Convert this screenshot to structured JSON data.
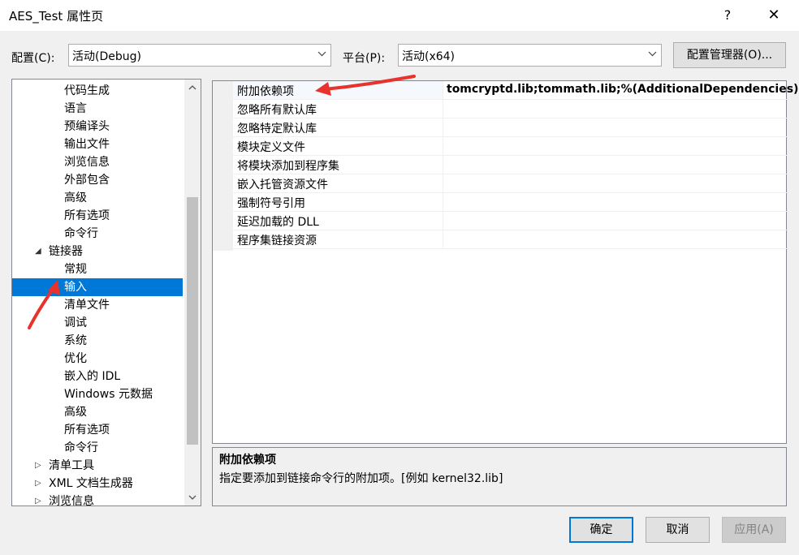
{
  "window": {
    "title": "AES_Test 属性页",
    "help_glyph": "?",
    "close_glyph": "✕"
  },
  "config": {
    "config_label": "配置(C):",
    "config_value": "活动(Debug)",
    "platform_label": "平台(P):",
    "platform_value": "活动(x64)",
    "manager_button": "配置管理器(O)..."
  },
  "tree": {
    "items": [
      {
        "label": "代码生成",
        "level": 2
      },
      {
        "label": "语言",
        "level": 2
      },
      {
        "label": "预编译头",
        "level": 2
      },
      {
        "label": "输出文件",
        "level": 2
      },
      {
        "label": "浏览信息",
        "level": 2
      },
      {
        "label": "外部包含",
        "level": 2
      },
      {
        "label": "高级",
        "level": 2
      },
      {
        "label": "所有选项",
        "level": 2
      },
      {
        "label": "命令行",
        "level": 2
      },
      {
        "label": "链接器",
        "level": 1,
        "expander": "◢"
      },
      {
        "label": "常规",
        "level": 2
      },
      {
        "label": "输入",
        "level": 2,
        "selected": true
      },
      {
        "label": "清单文件",
        "level": 2
      },
      {
        "label": "调试",
        "level": 2
      },
      {
        "label": "系统",
        "level": 2
      },
      {
        "label": "优化",
        "level": 2
      },
      {
        "label": "嵌入的 IDL",
        "level": 2
      },
      {
        "label": "Windows 元数据",
        "level": 2
      },
      {
        "label": "高级",
        "level": 2
      },
      {
        "label": "所有选项",
        "level": 2
      },
      {
        "label": "命令行",
        "level": 2
      },
      {
        "label": "清单工具",
        "level": 1,
        "expander": "▷"
      },
      {
        "label": "XML 文档生成器",
        "level": 1,
        "expander": "▷"
      },
      {
        "label": "浏览信息",
        "level": 1,
        "expander": "▷"
      }
    ]
  },
  "grid": {
    "rows": [
      {
        "name": "附加依赖项",
        "value": "tomcryptd.lib;tommath.lib;%(AdditionalDependencies)"
      },
      {
        "name": "忽略所有默认库",
        "value": ""
      },
      {
        "name": "忽略特定默认库",
        "value": ""
      },
      {
        "name": "模块定义文件",
        "value": ""
      },
      {
        "name": "将模块添加到程序集",
        "value": ""
      },
      {
        "name": "嵌入托管资源文件",
        "value": ""
      },
      {
        "name": "强制符号引用",
        "value": ""
      },
      {
        "name": "延迟加载的 DLL",
        "value": ""
      },
      {
        "name": "程序集链接资源",
        "value": ""
      }
    ]
  },
  "description": {
    "title": "附加依赖项",
    "text": "指定要添加到链接命令行的附加项。[例如 kernel32.lib]"
  },
  "buttons": {
    "ok": "确定",
    "cancel": "取消",
    "apply": "应用(A)"
  },
  "colors": {
    "selection": "#0078d7",
    "annotation_arrow": "#e8322c"
  }
}
